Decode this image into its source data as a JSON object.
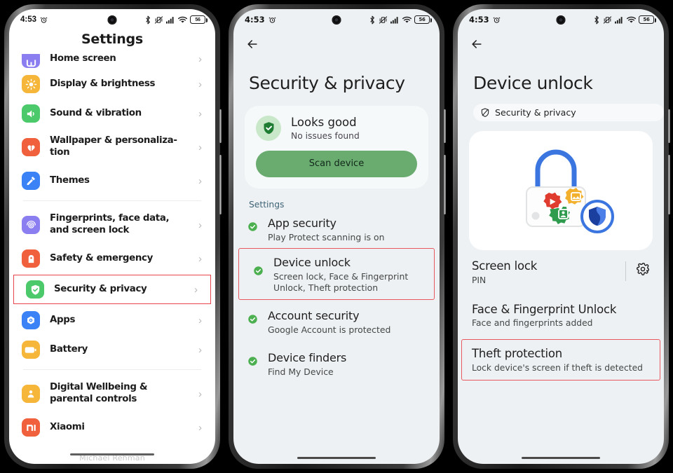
{
  "status_bar": {
    "time": "4:53",
    "icons_left": [
      "alarm-icon"
    ],
    "icons_right": [
      "bluetooth-icon",
      "vibrate-off-icon",
      "signal-icon",
      "wifi-icon",
      "battery-icon"
    ],
    "battery_level": "56"
  },
  "screen1": {
    "title": "Settings",
    "items": [
      {
        "label": "Home screen",
        "icon": "home-screen-icon",
        "color": "#8b7ef0",
        "partial": true
      },
      {
        "label": "Display & brightness",
        "icon": "brightness-icon",
        "color": "#f5b63a"
      },
      {
        "label": "Sound & vibration",
        "icon": "volume-icon",
        "color": "#4cc96a"
      },
      {
        "label": "Wallpaper & personaliza-\ntion",
        "icon": "wallpaper-icon",
        "color": "#f0603c"
      },
      {
        "label": "Themes",
        "icon": "themes-icon",
        "color": "#3b82f6"
      },
      {
        "label": "Fingerprints, face data,\nand screen lock",
        "icon": "fingerprint-icon",
        "color": "#8b7ef0"
      },
      {
        "label": "Safety & emergency",
        "icon": "safety-icon",
        "color": "#f0603c"
      },
      {
        "label": "Security & privacy",
        "icon": "shield-check-icon",
        "color": "#4cc96a",
        "highlighted": true
      },
      {
        "label": "Apps",
        "icon": "apps-icon",
        "color": "#3b82f6"
      },
      {
        "label": "Battery",
        "icon": "battery-settings-icon",
        "color": "#f5b63a"
      },
      {
        "label": "Digital Wellbeing &\nparental controls",
        "icon": "wellbeing-icon",
        "color": "#f5b63a"
      },
      {
        "label": "Xiaomi",
        "icon": "xiaomi-icon",
        "color": "#f0603c"
      }
    ],
    "chevron": "›",
    "watermark": "Michael Rehman"
  },
  "screen2": {
    "back": "back-arrow-icon",
    "title": "Security & privacy",
    "status_card": {
      "title": "Looks good",
      "subtitle": "No issues found",
      "button": "Scan device",
      "accent": "#6aab6f"
    },
    "section_label": "Settings",
    "items": [
      {
        "title": "App security",
        "subtitle": "Play Protect scanning is on",
        "state": "ok"
      },
      {
        "title": "Device unlock",
        "subtitle": "Screen lock, Face & Fingerprint\nUnlock, Theft protection",
        "state": "ok",
        "highlighted": true
      },
      {
        "title": "Account security",
        "subtitle": "Google Account is protected",
        "state": "ok"
      },
      {
        "title": "Device finders",
        "subtitle": "Find My Device",
        "state": "ok"
      }
    ]
  },
  "screen3": {
    "back": "back-arrow-icon",
    "title": "Device unlock",
    "chip": {
      "label": "Security & privacy",
      "icon": "shield-slash-icon"
    },
    "illustration": "device-unlock-illustration",
    "items": [
      {
        "title": "Screen lock",
        "subtitle": "PIN",
        "trailing_icon": "gear-icon"
      },
      {
        "title": "Face & Fingerprint Unlock",
        "subtitle": "Face and fingerprints added"
      },
      {
        "title": "Theft protection",
        "subtitle": "Lock device's screen if theft is detected",
        "highlighted": true
      }
    ]
  },
  "highlight_color": "#e8444c"
}
